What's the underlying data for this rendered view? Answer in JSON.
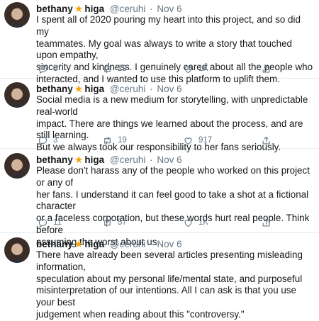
{
  "tweets": [
    {
      "name": "bethany",
      "badge": "★",
      "name2": "higa",
      "handle": "@ceruhi",
      "sep": "·",
      "date": "Nov 6",
      "lines": [
        "I spent all of 2020 pouring my heart into this project, and so did my",
        "teammates. My goal was always to write a story that touched upon empathy,",
        "sincerity and kindness. I genuinely cared about all the people who",
        "interacted, and I wanted to use this platform to uplift them."
      ],
      "replies": "8",
      "retweets": "29",
      "likes": "1K"
    },
    {
      "name": "bethany",
      "badge": "★",
      "name2": "higa",
      "handle": "@ceruhi",
      "sep": "·",
      "date": "Nov 6",
      "lines": [
        "Social media is a new medium for storytelling, with unpredictable real-world",
        "impact. There are things we learned about the process, and are still learning.",
        "But we always took our responsibility to her fans seriously."
      ],
      "replies": "3",
      "retweets": "19",
      "likes": "917"
    },
    {
      "name": "bethany",
      "badge": "★",
      "name2": "higa",
      "handle": "@ceruhi",
      "sep": "·",
      "date": "Nov 6",
      "lines": [
        "Please don't harass any of the people who worked on this project or any of",
        "her fans. I understand it can feel good to take a shot at a fictional character",
        "or a faceless corporation, but these words hurt real people. Think before",
        "assuming the worst about us."
      ],
      "replies": "11",
      "retweets": "57",
      "likes": "1K"
    },
    {
      "name": "bethany",
      "badge": "★",
      "name2": "higa",
      "handle": "@ceruhi",
      "sep": "·",
      "date": "Nov 6",
      "lines": [
        "There have already been several articles presenting misleading information,",
        "speculation about my personal life/mental state, and purposeful",
        "misinterpretation of our intentions. All I can ask is that you use your best",
        "judgement when reading about this \"controversy.\""
      ]
    }
  ],
  "icons": {
    "reply": "reply-icon",
    "retweet": "retweet-icon",
    "like": "heart-icon",
    "share": "share-icon"
  },
  "colors": {
    "text": "#14171a",
    "muted": "#657786",
    "badge": "#f4a300",
    "divider": "#e6ecf0"
  }
}
